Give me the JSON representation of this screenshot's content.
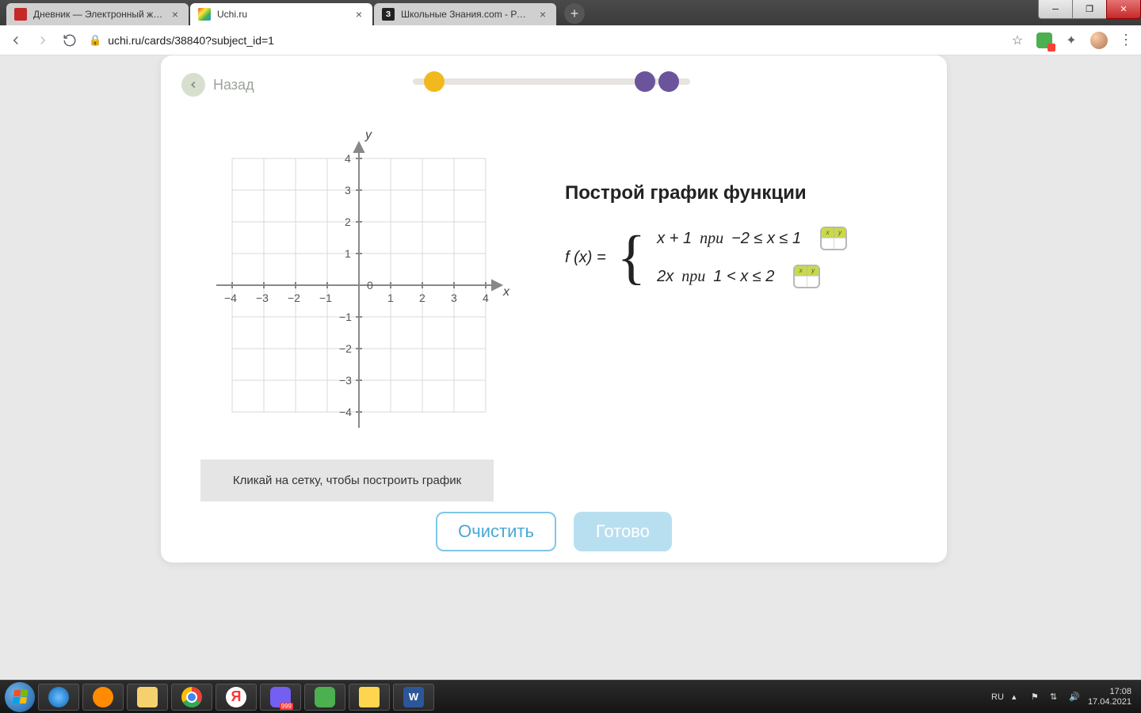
{
  "browser": {
    "tabs": [
      {
        "title": "Дневник — Электронный журн",
        "active": false
      },
      {
        "title": "Uchi.ru",
        "active": true
      },
      {
        "title": "Школьные Знания.com - Решае",
        "active": false
      }
    ],
    "url": "uchi.ru/cards/38840?subject_id=1"
  },
  "page": {
    "back_label": "Назад",
    "hint": "Кликай на сетку, чтобы построить график",
    "buttons": {
      "clear": "Очистить",
      "done": "Готово"
    },
    "task_title": "Построй график функции",
    "function_label": "f (x) =",
    "pieces": [
      {
        "expr": "x + 1",
        "pri": "при",
        "cond": "−2 ≤ x ≤ 1"
      },
      {
        "expr": "2x",
        "pri": "при",
        "cond": "1 < x ≤ 2"
      }
    ],
    "axes": {
      "y_label": "y",
      "x_label": "x",
      "origin": "0",
      "x_ticks": [
        "−4",
        "−3",
        "−2",
        "−1",
        "1",
        "2",
        "3",
        "4"
      ],
      "y_ticks_pos": [
        "4",
        "3",
        "2",
        "1"
      ],
      "y_ticks_neg": [
        "−1",
        "−2",
        "−3",
        "−4"
      ]
    },
    "table_icon": {
      "hx": "x",
      "hy": "y"
    }
  },
  "system": {
    "lang": "RU",
    "time": "17:08",
    "date": "17.04.2021"
  }
}
